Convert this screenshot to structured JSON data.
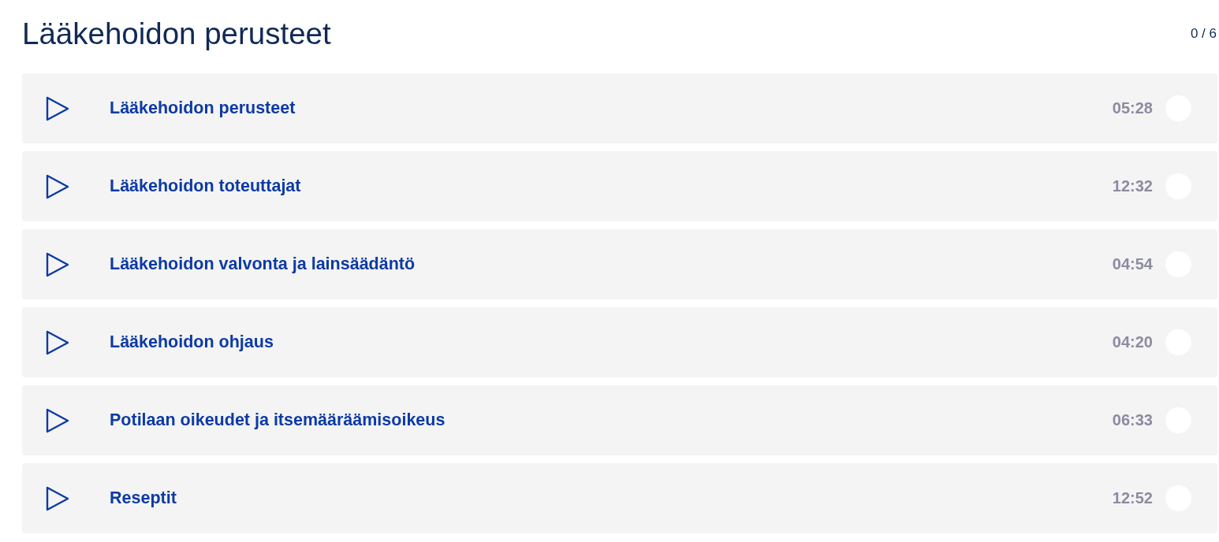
{
  "heading": {
    "title": "Lääkehoidon perusteet",
    "progress": "0 / 6"
  },
  "lessons": [
    {
      "title": "Lääkehoidon perusteet",
      "duration": "05:28",
      "completed": false
    },
    {
      "title": "Lääkehoidon toteuttajat",
      "duration": "12:32",
      "completed": false
    },
    {
      "title": "Lääkehoidon valvonta ja lainsäädäntö",
      "duration": "04:54",
      "completed": false
    },
    {
      "title": "Lääkehoidon ohjaus",
      "duration": "04:20",
      "completed": false
    },
    {
      "title": "Potilaan oikeudet ja itsemääräämisoikeus",
      "duration": "06:33",
      "completed": false
    },
    {
      "title": "Reseptit",
      "duration": "12:52",
      "completed": false
    }
  ]
}
